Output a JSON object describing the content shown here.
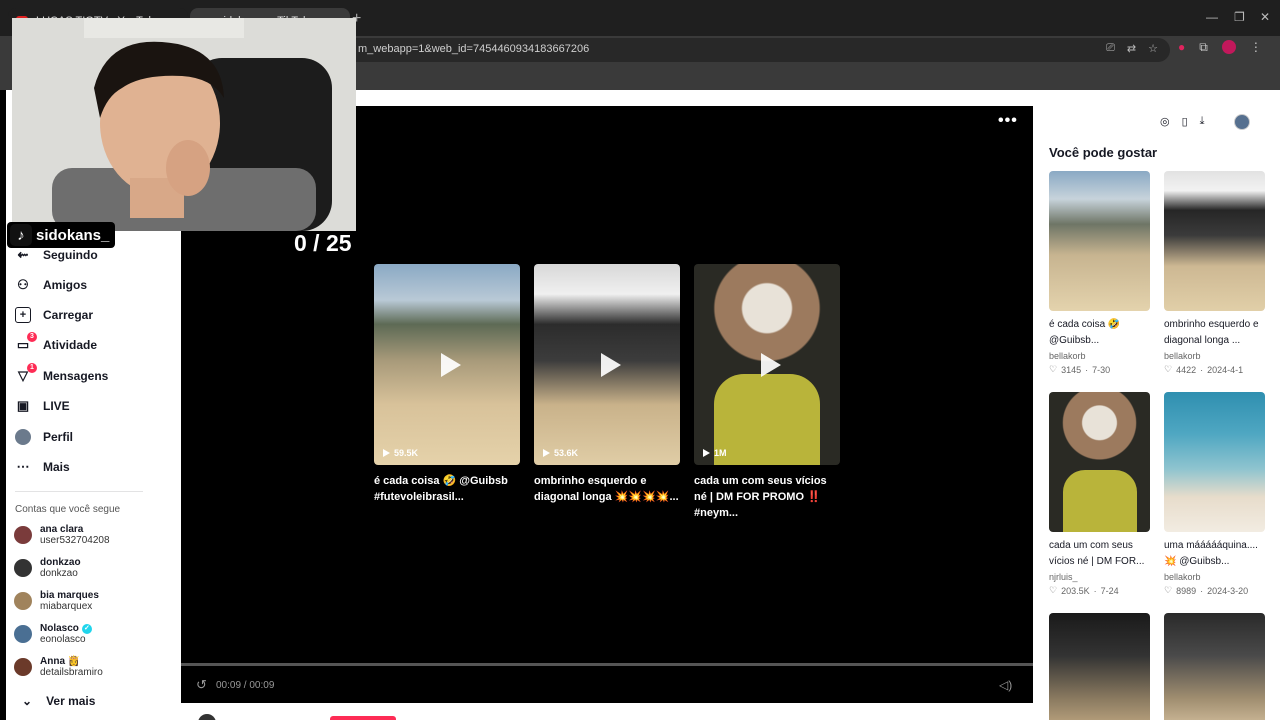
{
  "browser": {
    "tabs": [
      {
        "label": "LUCAS TIGTV - YouTube"
      },
      {
        "label": "sidokans_ - TikTok"
      }
    ],
    "url": "m_webapp=1&web_id=7454460934183667206"
  },
  "nav": {
    "items": [
      {
        "label": "Seguindo",
        "icon": "following-icon"
      },
      {
        "label": "Amigos",
        "icon": "friends-icon"
      },
      {
        "label": "Carregar",
        "icon": "upload-icon"
      },
      {
        "label": "Atividade",
        "icon": "activity-icon",
        "badge": "3"
      },
      {
        "label": "Mensagens",
        "icon": "messages-icon",
        "badge": "1"
      },
      {
        "label": "LIVE",
        "icon": "live-icon"
      },
      {
        "label": "Perfil",
        "icon": "profile-avatar"
      },
      {
        "label": "Mais",
        "icon": "more-icon"
      }
    ],
    "following_title": "Contas que você segue",
    "accounts": [
      {
        "name": "ana clara",
        "handle": "user532704208",
        "color": "#7a3b3b"
      },
      {
        "name": "donkzao",
        "handle": "donkzao",
        "color": "#333333"
      },
      {
        "name": "bia marques",
        "handle": "miabarquex",
        "color": "#a0835c"
      },
      {
        "name": "Nolasco",
        "handle": "eonolasco",
        "color": "#4a6f93",
        "verified": true
      },
      {
        "name": "Anna 👸",
        "handle": "detailsbramiro",
        "color": "#6b3a2a"
      }
    ],
    "see_more": "Ver mais"
  },
  "player": {
    "counter": "0 / 25",
    "time": "00:09 / 00:09",
    "videos": [
      {
        "views": "59.5K",
        "caption": "é cada coisa 🤣 @Guibsb #futevoleibrasil..."
      },
      {
        "views": "53.6K",
        "caption": "ombrinho esquerdo e diagonal longa 💥💥💥💥..."
      },
      {
        "views": "1M",
        "caption": "cada um com seus vícios né | DM FOR PROMO ‼️ #neym..."
      }
    ]
  },
  "recommendations": {
    "title": "Você pode gostar",
    "items": [
      {
        "caption": "é cada coisa 🤣 @Guibsb...",
        "author": "bellakorb",
        "likes": "3145",
        "date": "7-30"
      },
      {
        "caption": "ombrinho esquerdo e diagonal longa ...",
        "author": "bellakorb",
        "likes": "4422",
        "date": "2024-4-1"
      },
      {
        "caption": "cada um com seus vícios né | DM FOR...",
        "author": "njrluis_",
        "likes": "203.5K",
        "date": "7-24"
      },
      {
        "caption": "uma máááááquina.... 💥 @Guibsb...",
        "author": "bellakorb",
        "likes": "8989",
        "date": "2024-3-20"
      }
    ]
  },
  "webcam": {
    "username": "sidokans_"
  }
}
